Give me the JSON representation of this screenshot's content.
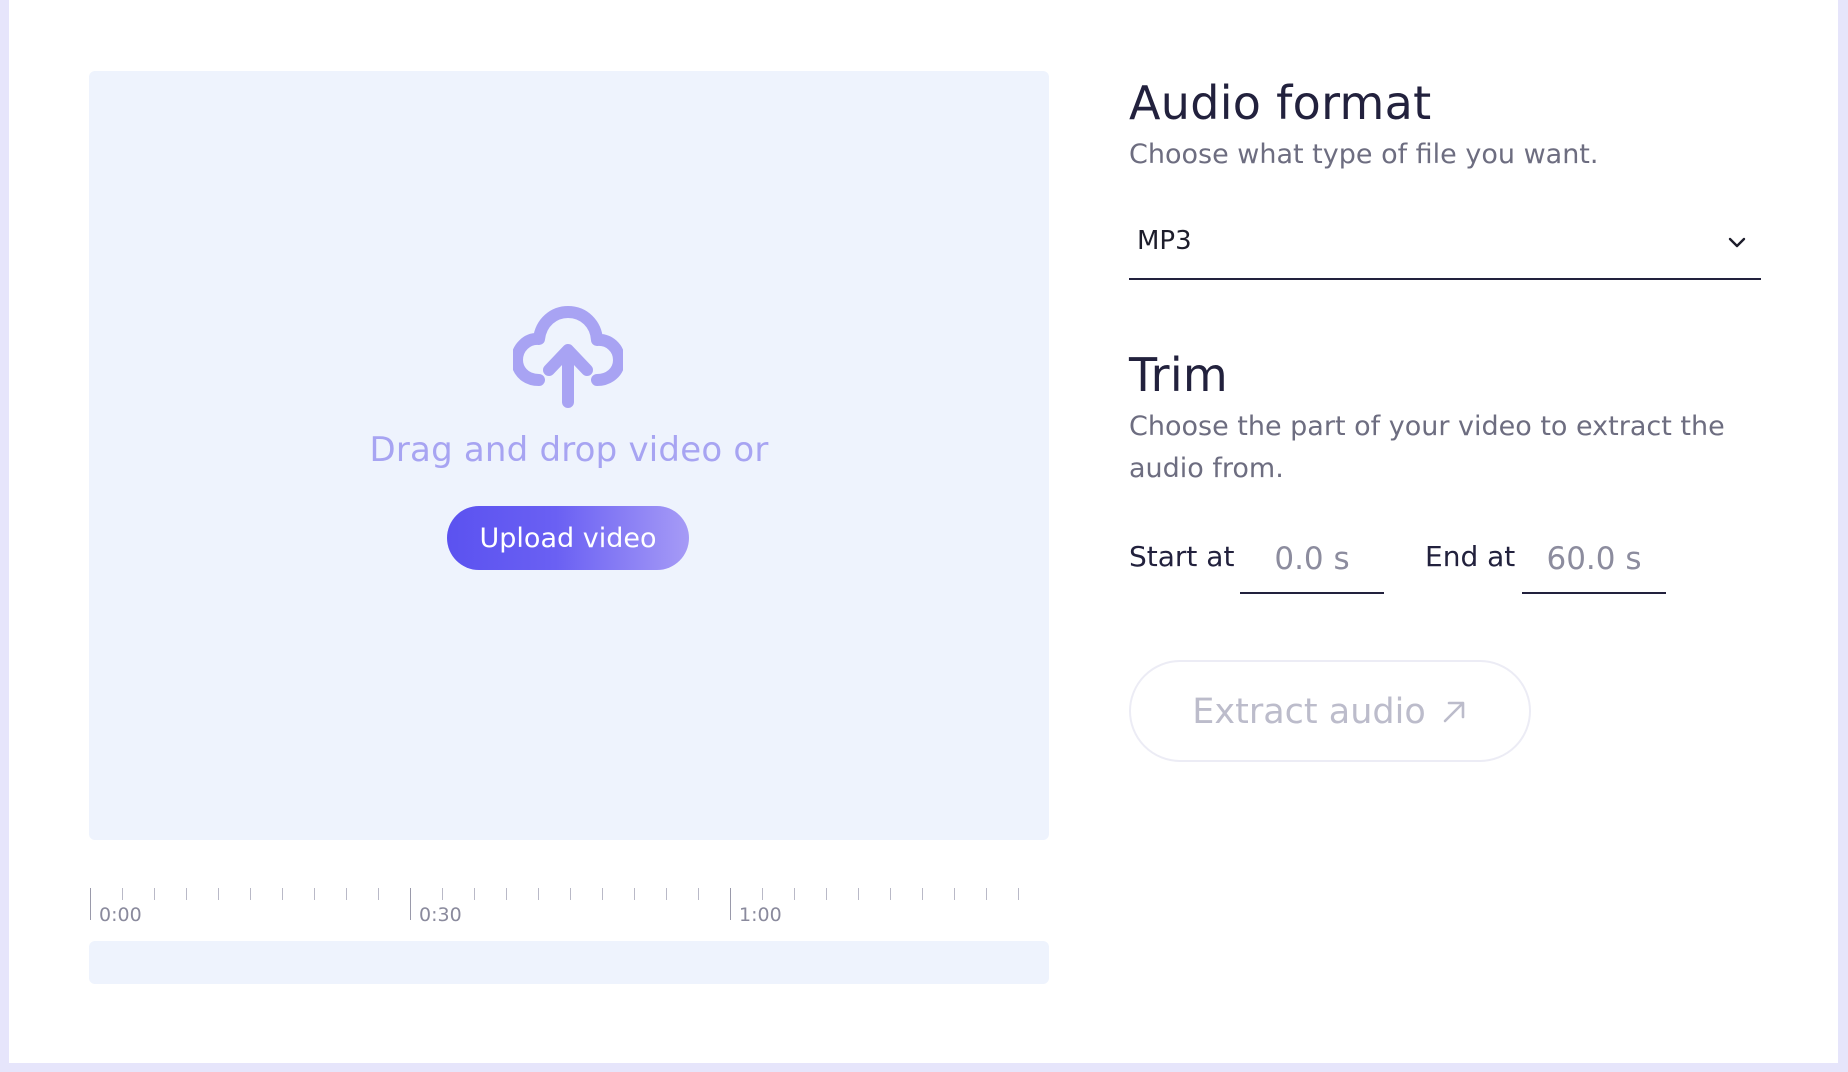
{
  "upload": {
    "drop_text": "Drag and drop video or",
    "button_label": "Upload video",
    "icon": "cloud-upload-icon"
  },
  "timeline": {
    "labels": [
      "0:00",
      "0:30",
      "1:00"
    ]
  },
  "audio_format": {
    "title": "Audio format",
    "subtitle": "Choose what type of file you want.",
    "selected": "MP3",
    "icon": "chevron-down-icon"
  },
  "trim": {
    "title": "Trim",
    "subtitle": "Choose the part of your video to extract the audio from.",
    "start_label": "Start at",
    "start_value": "0.0 s",
    "end_label": "End at",
    "end_value": "60.0 s"
  },
  "extract": {
    "label": "Extract audio",
    "icon": "arrow-up-right-icon"
  },
  "colors": {
    "accent": "#5b52f0",
    "dropzone_bg": "#eef3fd",
    "heading": "#22213d",
    "muted": "#6d6d80"
  }
}
